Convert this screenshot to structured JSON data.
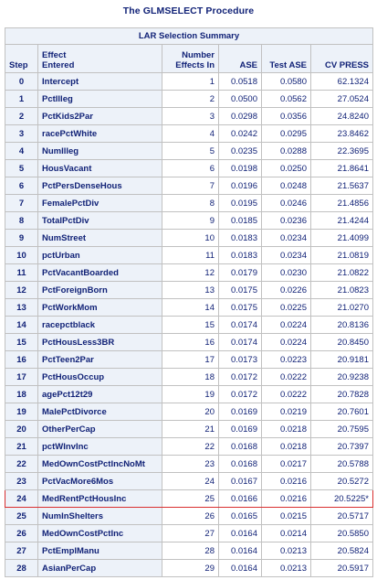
{
  "title": "The GLMSELECT Procedure",
  "table": {
    "caption": "LAR Selection Summary",
    "headers": {
      "step": "Step",
      "effect_line1": "Effect",
      "effect_line2": "Entered",
      "number_line1": "Number",
      "number_line2": "Effects In",
      "ase": "ASE",
      "test_ase": "Test ASE",
      "cv_press": "CV PRESS"
    },
    "rows": [
      {
        "step": "0",
        "effect": "Intercept",
        "number": "1",
        "ase": "0.0518",
        "test_ase": "0.0580",
        "cv_press": "62.1324"
      },
      {
        "step": "1",
        "effect": "PctIlleg",
        "number": "2",
        "ase": "0.0500",
        "test_ase": "0.0562",
        "cv_press": "27.0524"
      },
      {
        "step": "2",
        "effect": "PctKids2Par",
        "number": "3",
        "ase": "0.0298",
        "test_ase": "0.0356",
        "cv_press": "24.8240"
      },
      {
        "step": "3",
        "effect": "racePctWhite",
        "number": "4",
        "ase": "0.0242",
        "test_ase": "0.0295",
        "cv_press": "23.8462"
      },
      {
        "step": "4",
        "effect": "NumIlleg",
        "number": "5",
        "ase": "0.0235",
        "test_ase": "0.0288",
        "cv_press": "22.3695"
      },
      {
        "step": "5",
        "effect": "HousVacant",
        "number": "6",
        "ase": "0.0198",
        "test_ase": "0.0250",
        "cv_press": "21.8641"
      },
      {
        "step": "6",
        "effect": "PctPersDenseHous",
        "number": "7",
        "ase": "0.0196",
        "test_ase": "0.0248",
        "cv_press": "21.5637"
      },
      {
        "step": "7",
        "effect": "FemalePctDiv",
        "number": "8",
        "ase": "0.0195",
        "test_ase": "0.0246",
        "cv_press": "21.4856"
      },
      {
        "step": "8",
        "effect": "TotalPctDiv",
        "number": "9",
        "ase": "0.0185",
        "test_ase": "0.0236",
        "cv_press": "21.4244"
      },
      {
        "step": "9",
        "effect": "NumStreet",
        "number": "10",
        "ase": "0.0183",
        "test_ase": "0.0234",
        "cv_press": "21.4099"
      },
      {
        "step": "10",
        "effect": "pctUrban",
        "number": "11",
        "ase": "0.0183",
        "test_ase": "0.0234",
        "cv_press": "21.0819"
      },
      {
        "step": "11",
        "effect": "PctVacantBoarded",
        "number": "12",
        "ase": "0.0179",
        "test_ase": "0.0230",
        "cv_press": "21.0822"
      },
      {
        "step": "12",
        "effect": "PctForeignBorn",
        "number": "13",
        "ase": "0.0175",
        "test_ase": "0.0226",
        "cv_press": "21.0823"
      },
      {
        "step": "13",
        "effect": "PctWorkMom",
        "number": "14",
        "ase": "0.0175",
        "test_ase": "0.0225",
        "cv_press": "21.0270"
      },
      {
        "step": "14",
        "effect": "racepctblack",
        "number": "15",
        "ase": "0.0174",
        "test_ase": "0.0224",
        "cv_press": "20.8136"
      },
      {
        "step": "15",
        "effect": "PctHousLess3BR",
        "number": "16",
        "ase": "0.0174",
        "test_ase": "0.0224",
        "cv_press": "20.8450"
      },
      {
        "step": "16",
        "effect": "PctTeen2Par",
        "number": "17",
        "ase": "0.0173",
        "test_ase": "0.0223",
        "cv_press": "20.9181"
      },
      {
        "step": "17",
        "effect": "PctHousOccup",
        "number": "18",
        "ase": "0.0172",
        "test_ase": "0.0222",
        "cv_press": "20.9238"
      },
      {
        "step": "18",
        "effect": "agePct12t29",
        "number": "19",
        "ase": "0.0172",
        "test_ase": "0.0222",
        "cv_press": "20.7828"
      },
      {
        "step": "19",
        "effect": "MalePctDivorce",
        "number": "20",
        "ase": "0.0169",
        "test_ase": "0.0219",
        "cv_press": "20.7601"
      },
      {
        "step": "20",
        "effect": "OtherPerCap",
        "number": "21",
        "ase": "0.0169",
        "test_ase": "0.0218",
        "cv_press": "20.7595"
      },
      {
        "step": "21",
        "effect": "pctWInvInc",
        "number": "22",
        "ase": "0.0168",
        "test_ase": "0.0218",
        "cv_press": "20.7397"
      },
      {
        "step": "22",
        "effect": "MedOwnCostPctIncNoMt",
        "number": "23",
        "ase": "0.0168",
        "test_ase": "0.0217",
        "cv_press": "20.5788"
      },
      {
        "step": "23",
        "effect": "PctVacMore6Mos",
        "number": "24",
        "ase": "0.0167",
        "test_ase": "0.0216",
        "cv_press": "20.5272"
      },
      {
        "step": "24",
        "effect": "MedRentPctHousInc",
        "number": "25",
        "ase": "0.0166",
        "test_ase": "0.0216",
        "cv_press": "20.5225*",
        "selected": true
      },
      {
        "step": "25",
        "effect": "NumInShelters",
        "number": "26",
        "ase": "0.0165",
        "test_ase": "0.0215",
        "cv_press": "20.5717"
      },
      {
        "step": "26",
        "effect": "MedOwnCostPctInc",
        "number": "27",
        "ase": "0.0164",
        "test_ase": "0.0214",
        "cv_press": "20.5850"
      },
      {
        "step": "27",
        "effect": "PctEmplManu",
        "number": "28",
        "ase": "0.0164",
        "test_ase": "0.0213",
        "cv_press": "20.5824"
      },
      {
        "step": "28",
        "effect": "AsianPerCap",
        "number": "29",
        "ase": "0.0164",
        "test_ase": "0.0213",
        "cv_press": "20.5917"
      }
    ]
  },
  "colors": {
    "text": "#112277",
    "header_bg": "#edf2f9",
    "grid": "#c1c1c1",
    "highlight": "#d93030"
  }
}
